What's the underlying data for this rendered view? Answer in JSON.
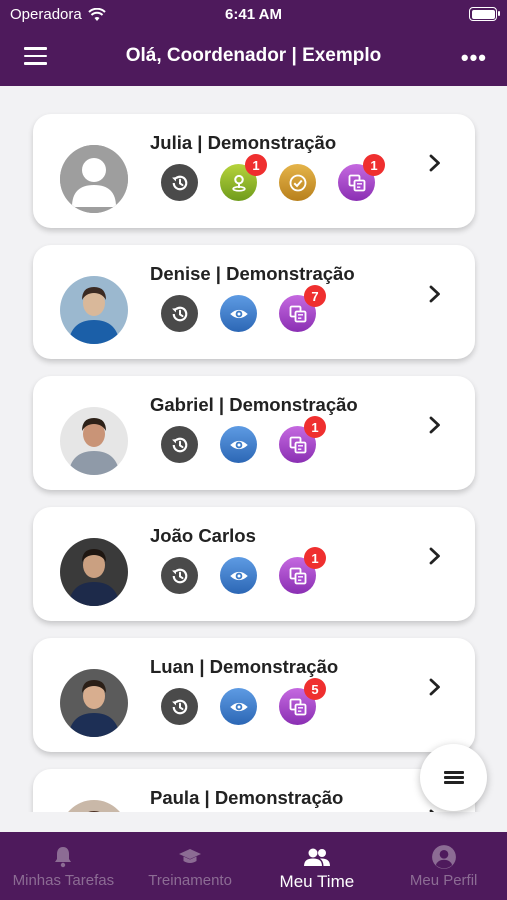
{
  "status": {
    "carrier": "Operadora",
    "time": "6:41 AM"
  },
  "header": {
    "title": "Olá, Coordenador | Exemplo"
  },
  "members": [
    {
      "name": "Julia | Demonstração",
      "avatar": "placeholder",
      "actions": [
        {
          "icon": "history-icon",
          "type": "history",
          "badge": ""
        },
        {
          "icon": "map-pin-icon",
          "type": "map",
          "badge": "1"
        },
        {
          "icon": "check-circle-icon",
          "type": "check",
          "badge": ""
        },
        {
          "icon": "copy-icon",
          "type": "copy",
          "badge": "1"
        }
      ]
    },
    {
      "name": "Denise | Demonstração",
      "avatar": "photo",
      "actions": [
        {
          "icon": "history-icon",
          "type": "history",
          "badge": ""
        },
        {
          "icon": "eye-icon",
          "type": "eye",
          "badge": ""
        },
        {
          "icon": "copy-icon",
          "type": "copy",
          "badge": "7"
        }
      ]
    },
    {
      "name": "Gabriel | Demonstração",
      "avatar": "photo",
      "actions": [
        {
          "icon": "history-icon",
          "type": "history",
          "badge": ""
        },
        {
          "icon": "eye-icon",
          "type": "eye",
          "badge": ""
        },
        {
          "icon": "copy-icon",
          "type": "copy",
          "badge": "1"
        }
      ]
    },
    {
      "name": "João Carlos",
      "avatar": "photo",
      "actions": [
        {
          "icon": "history-icon",
          "type": "history",
          "badge": ""
        },
        {
          "icon": "eye-icon",
          "type": "eye",
          "badge": ""
        },
        {
          "icon": "copy-icon",
          "type": "copy",
          "badge": "1"
        }
      ]
    },
    {
      "name": "Luan | Demonstração",
      "avatar": "photo",
      "actions": [
        {
          "icon": "history-icon",
          "type": "history",
          "badge": ""
        },
        {
          "icon": "eye-icon",
          "type": "eye",
          "badge": ""
        },
        {
          "icon": "copy-icon",
          "type": "copy",
          "badge": "5"
        }
      ]
    },
    {
      "name": "Paula | Demonstração",
      "avatar": "photo",
      "actions": []
    }
  ],
  "tabs": [
    {
      "label": "Minhas Tarefas",
      "icon": "bell-icon",
      "active": false
    },
    {
      "label": "Treinamento",
      "icon": "graduation-cap-icon",
      "active": false
    },
    {
      "label": "Meu Time",
      "icon": "team-icon",
      "active": true
    },
    {
      "label": "Meu Perfil",
      "icon": "profile-icon",
      "active": false
    }
  ],
  "colors": {
    "brand": "#4e1a5c",
    "badge": "#ef2f2f"
  }
}
